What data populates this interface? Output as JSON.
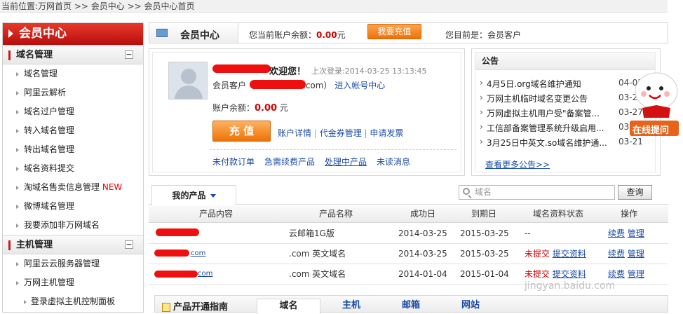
{
  "breadcrumb": "当前位置:万网首页 >> 会员中心 >> 会员中心首页",
  "sidebar": {
    "title": "会员中心",
    "sec1": "域名管理",
    "domain_items": [
      "域名管理",
      "阿里云解析",
      "域名过户管理",
      "转入域名管理",
      "转出域名管理",
      "域名资料提交",
      "淘域名售卖信息管理",
      "微博域名管理",
      "我要添加非万网域名"
    ],
    "new_badge": "NEW",
    "sec2": "主机管理",
    "host_items": [
      "阿里云云服务器管理",
      "万网主机管理",
      "登录虚拟主机控制面板"
    ],
    "toggle": "−"
  },
  "topbar": {
    "tab": "会员中心",
    "bal_label": "您当前账户余额：",
    "bal_value": "0.00",
    "bal_unit": "元",
    "recharge_btn": "我要充值",
    "level": "您目前是：会员客户"
  },
  "welcome": {
    "greet": "欢迎您！",
    "last_login": "上次登录:2014-03-25  13:13:45",
    "acct_prefix": "会员客户（",
    "acct_suffix": ".com）",
    "acct_link": "进入帐号中心",
    "balance_label": "账户余额：",
    "balance_value": "0.00",
    "balance_unit": "元",
    "chong_btn": "充 值",
    "links": [
      "账户详情",
      "代金券管理",
      "申请发票"
    ],
    "bottom_links": [
      "未付款订单",
      "急需续费产品",
      "处理中产品",
      "未读消息"
    ]
  },
  "announce": {
    "title": "公告",
    "items": [
      {
        "t": "4月5日.org域名维护通知",
        "d": "04-03"
      },
      {
        "t": "万网主机临时域名变更公告",
        "d": "03-28"
      },
      {
        "t": "万网虚拟主机用户受\"备案管...",
        "d": "03-27"
      },
      {
        "t": "工信部备案管理系统升级启用...",
        "d": "03-24"
      },
      {
        "t": "3月25日中英文.so域名维护通...",
        "d": "03-21"
      }
    ],
    "more": "查看更多公告>>"
  },
  "mascot": {
    "label": "在线提问"
  },
  "products": {
    "tab": "我的产品",
    "search_placeholder": "域名",
    "query_btn": "查询",
    "headers": [
      "产品内容",
      "产品名称",
      "成功日",
      "到期日",
      "域名资料状态",
      "操作"
    ],
    "rows": [
      {
        "content": "",
        "name": "云邮箱1G版",
        "start": "2014-03-25",
        "end": "2015-03-25",
        "status": "--",
        "status_red": "",
        "actions": [
          "续费",
          "管理"
        ]
      },
      {
        "content": "com",
        "name": ".com 英文域名",
        "start": "2014-03-25",
        "end": "2015-03-25",
        "status": "提交资料",
        "status_red": "未提交",
        "actions": [
          "续费",
          "管理"
        ]
      },
      {
        "content": "com",
        "name": ".com 英文域名",
        "start": "2014-01-04",
        "end": "2015-01-04",
        "status": "提交资料",
        "status_red": "未提交",
        "actions": [
          "续费",
          "管理"
        ]
      }
    ]
  },
  "guide": {
    "title": "产品开通指南",
    "tabs": [
      "域名",
      "主机",
      "邮箱",
      "网站"
    ]
  },
  "watermark": "jingyan.baidu.com",
  "colors": {
    "accent": "#c81a1a",
    "link": "#1a4aa6",
    "orange": "#ee7206"
  }
}
